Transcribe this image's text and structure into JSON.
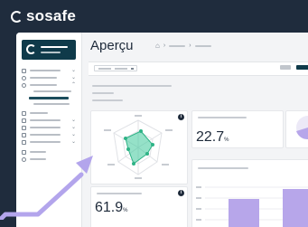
{
  "brand": {
    "name": "sosafe"
  },
  "page": {
    "title": "Aperçu"
  },
  "breadcrumb": {
    "home_icon": "home-icon"
  },
  "kpis": [
    {
      "value": "22.7",
      "unit": "%"
    },
    {
      "value": "61.9",
      "unit": "%"
    }
  ],
  "colors": {
    "background": "#1f2c3d",
    "brand_dark": "#0f3a4a",
    "radar_fill": "#3ec99a",
    "bars": "#b7a6ea",
    "arrow": "#b3a5ec"
  }
}
